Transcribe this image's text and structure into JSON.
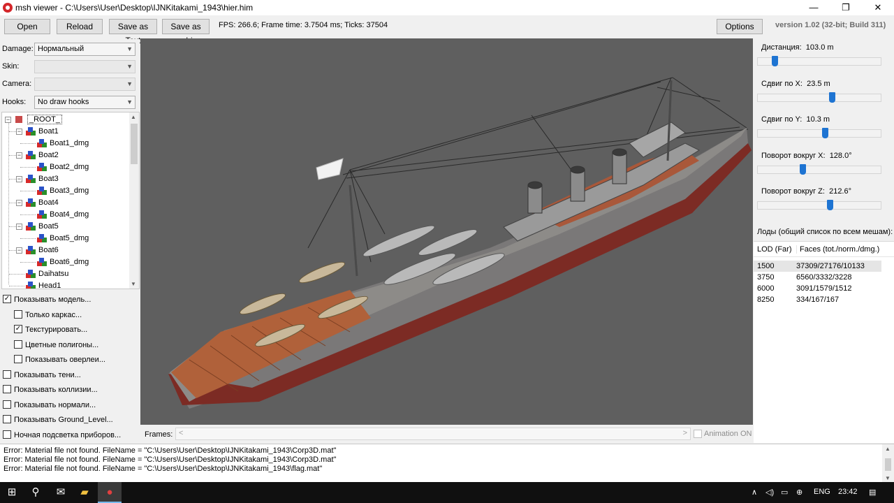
{
  "window": {
    "title": "msh viewer - C:\\Users\\User\\Desktop\\IJNKitakami_1943\\hier.him",
    "min_glyph": "—",
    "max_glyph": "❐",
    "close_glyph": "✕"
  },
  "toolbar": {
    "open_label": "Open",
    "reload_label": "Reload",
    "save_text_label": "Save as Text",
    "save_obj_label": "Save as .obj",
    "status": "FPS: 266.6; Frame time: 3.7504 ms; Ticks: 37504",
    "options_label": "Options",
    "version": "version 1.02 (32-bit; Build 311)"
  },
  "left": {
    "damage_label": "Damage:",
    "damage_value": "Нормальный",
    "skin_label": "Skin:",
    "skin_value": "",
    "camera_label": "Camera:",
    "camera_value": "",
    "hooks_label": "Hooks:",
    "hooks_value": "No draw hooks",
    "tree": {
      "root": "_ROOT_",
      "items": [
        {
          "label": "Boat1",
          "child": "Boat1_dmg"
        },
        {
          "label": "Boat2",
          "child": "Boat2_dmg"
        },
        {
          "label": "Boat3",
          "child": "Boat3_dmg"
        },
        {
          "label": "Boat4",
          "child": "Boat4_dmg"
        },
        {
          "label": "Boat5",
          "child": "Boat5_dmg"
        },
        {
          "label": "Boat6",
          "child": "Boat6_dmg"
        }
      ],
      "daihatsu": "Daihatsu",
      "head1": "Head1"
    },
    "checks": [
      {
        "label": "Показывать модель...",
        "checked": true
      },
      {
        "label": "Только каркас...",
        "checked": false
      },
      {
        "label": "Текстурировать...",
        "checked": true
      },
      {
        "label": "Цветные полигоны...",
        "checked": false
      },
      {
        "label": "Показывать оверлеи...",
        "checked": false
      },
      {
        "label": "Показывать тени...",
        "checked": false
      },
      {
        "label": "Показывать коллизии...",
        "checked": false
      },
      {
        "label": "Показывать нормали...",
        "checked": false
      },
      {
        "label": "Показывать Ground_Level...",
        "checked": false
      },
      {
        "label": "Ночная подсветка приборов...",
        "checked": false
      }
    ]
  },
  "frames": {
    "label": "Frames:",
    "left_arrow": "<",
    "right_arrow": ">",
    "anim_label": "Animation ON"
  },
  "right": {
    "sliders": [
      {
        "label": "Дистанция:",
        "value": "103.0 m",
        "fraction": 0.12
      },
      {
        "label": "Сдвиг по X:",
        "value": "23.5 m",
        "fraction": 0.61
      },
      {
        "label": "Сдвиг по Y:",
        "value": "10.3 m",
        "fraction": 0.55
      },
      {
        "label": "Поворот вокруг X:",
        "value": "128.0°",
        "fraction": 0.36
      },
      {
        "label": "Поворот вокруг Z:",
        "value": "212.6°",
        "fraction": 0.59
      }
    ],
    "lod_caption": "Лоды (общий список по всем мешам):",
    "lod_head_far": "LOD (Far)",
    "lod_head_faces": "Faces (tot./norm./dmg.)",
    "lods": [
      {
        "far": "1500",
        "faces": "37309/27176/10133"
      },
      {
        "far": "3750",
        "faces": "6560/3332/3228"
      },
      {
        "far": "6000",
        "faces": "3091/1579/1512"
      },
      {
        "far": "8250",
        "faces": "334/167/167"
      }
    ]
  },
  "log": [
    "Error: Material file not found. FileName = \"C:\\Users\\User\\Desktop\\IJNKitakami_1943\\Corp3D.mat\"",
    "Error: Material file not found. FileName = \"C:\\Users\\User\\Desktop\\IJNKitakami_1943\\Corp3D.mat\"",
    "Error: Material file not found. FileName = \"C:\\Users\\User\\Desktop\\IJNKitakami_1943\\flag.mat\""
  ],
  "taskbar": {
    "lang": "ENG",
    "time": "23:42"
  },
  "colors": {
    "viewport_bg": "#5f5f5f",
    "slider_thumb": "#1e74d2",
    "hull": "#8c8c8c",
    "deck": "#b0613a",
    "waterline": "#7c2b24"
  }
}
